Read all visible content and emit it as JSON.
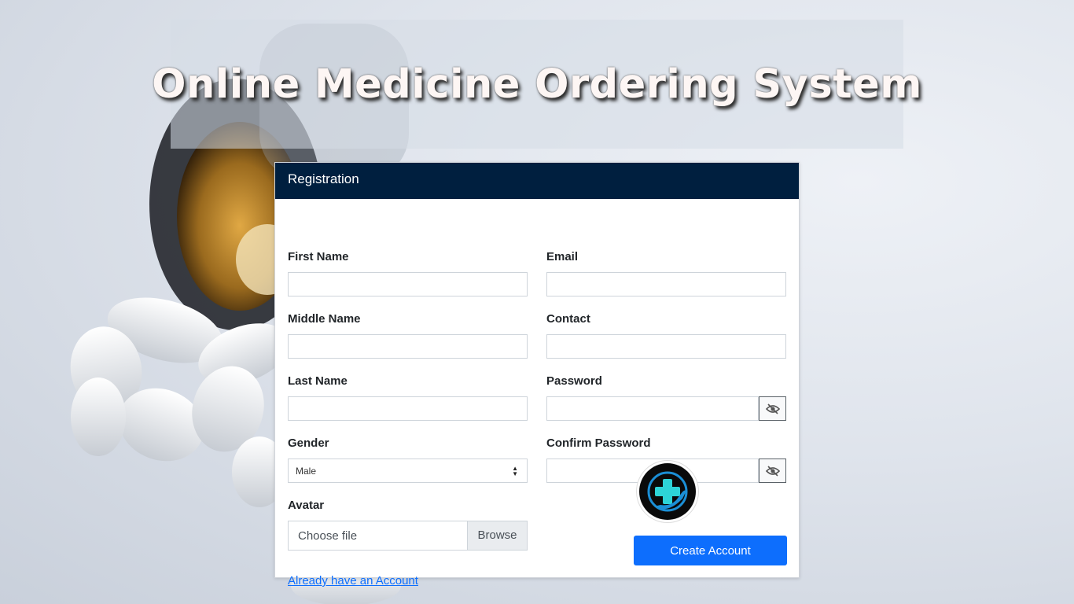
{
  "page": {
    "title": "Online Medicine Ordering System"
  },
  "card": {
    "header": "Registration"
  },
  "form": {
    "first_name_label": "First Name",
    "middle_name_label": "Middle Name",
    "last_name_label": "Last Name",
    "gender_label": "Gender",
    "gender_value": "Male",
    "avatar_label": "Avatar",
    "file_placeholder": "Choose file",
    "browse_label": "Browse",
    "email_label": "Email",
    "contact_label": "Contact",
    "password_label": "Password",
    "confirm_password_label": "Confirm Password",
    "login_link": "Already have an Account",
    "submit_label": "Create Account"
  },
  "icons": {
    "password_toggle": "eye-slash-icon",
    "logo": "medical-cross-hand-icon"
  },
  "colors": {
    "header_bg": "#001f3f",
    "primary": "#0d6efd",
    "link": "#0d6efd"
  }
}
